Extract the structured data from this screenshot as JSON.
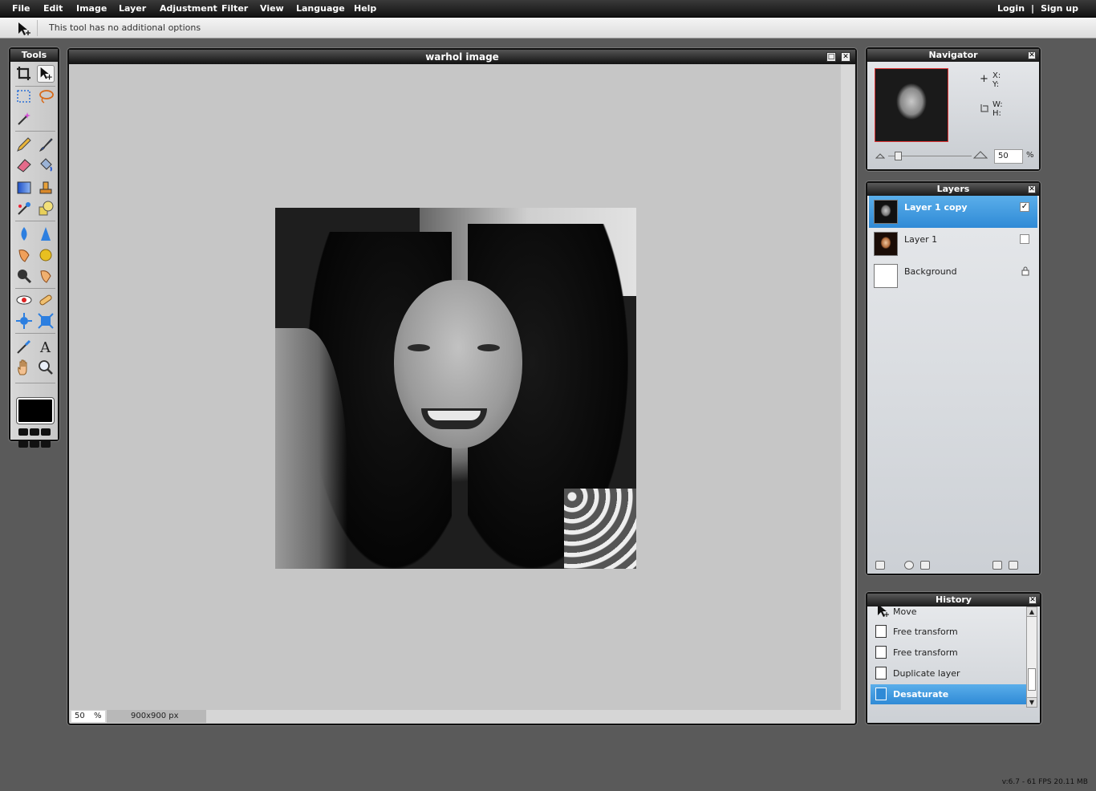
{
  "menubar": {
    "items": [
      "File",
      "Edit",
      "Image",
      "Layer",
      "Adjustment",
      "Filter",
      "View",
      "Language",
      "Help"
    ],
    "login": "Login",
    "separator": "|",
    "signup": "Sign up"
  },
  "options": {
    "message": "This tool has no additional options"
  },
  "tools": {
    "title": "Tools",
    "foreground_color": "#000000"
  },
  "image_window": {
    "title": "warhol image",
    "zoom_value": "50",
    "zoom_unit": "%",
    "dimensions": "900x900 px"
  },
  "navigator": {
    "title": "Navigator",
    "x_label": "X:",
    "y_label": "Y:",
    "w_label": "W:",
    "h_label": "H:",
    "zoom_value": "50",
    "zoom_unit": "%"
  },
  "layers": {
    "title": "Layers",
    "items": [
      {
        "name": "Layer 1 copy",
        "selected": true,
        "visible": true
      },
      {
        "name": "Layer 1",
        "selected": false,
        "visible": false
      },
      {
        "name": "Background",
        "selected": false,
        "locked": true
      }
    ]
  },
  "history": {
    "title": "History",
    "items": [
      "Move",
      "Free transform",
      "Free transform",
      "Duplicate layer",
      "Desaturate"
    ],
    "selected_index": 4
  },
  "footer": {
    "version": "v:6.7 - 61 FPS 20.11 MB"
  },
  "colors": {
    "selection_blue": "#3a94dd",
    "panel_title": "#1a1a1a",
    "workspace": "#5a5a5a"
  }
}
